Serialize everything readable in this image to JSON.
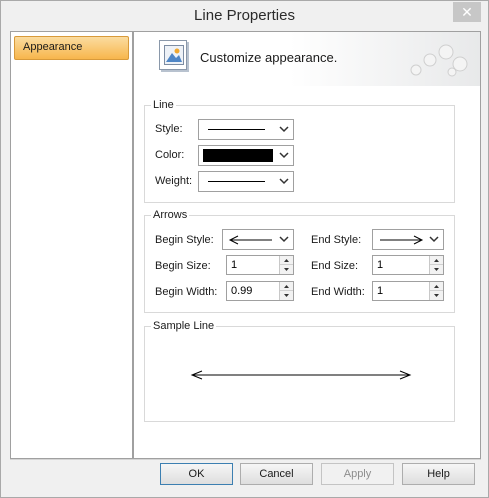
{
  "window": {
    "title": "Line Properties",
    "close_glyph": "✕"
  },
  "sidebar": {
    "items": [
      {
        "label": "Appearance",
        "selected": true
      }
    ]
  },
  "header": {
    "text": "Customize appearance.",
    "icon": "picture-icon"
  },
  "line_group": {
    "title": "Line",
    "style_label": "Style:",
    "color_label": "Color:",
    "weight_label": "Weight:",
    "color_value": "#000000"
  },
  "arrows_group": {
    "title": "Arrows",
    "begin_style_label": "Begin Style:",
    "end_style_label": "End Style:",
    "begin_size_label": "Begin Size:",
    "end_size_label": "End Size:",
    "begin_width_label": "Begin Width:",
    "end_width_label": "End Width:",
    "begin_size_value": "1",
    "end_size_value": "1",
    "begin_width_value": "0.99",
    "end_width_value": "1"
  },
  "sample_group": {
    "title": "Sample Line"
  },
  "buttons": {
    "ok": "OK",
    "cancel": "Cancel",
    "apply": "Apply",
    "help": "Help"
  },
  "colors": {
    "accent": "#f7b64c",
    "selected_border": "#d89a3a"
  }
}
